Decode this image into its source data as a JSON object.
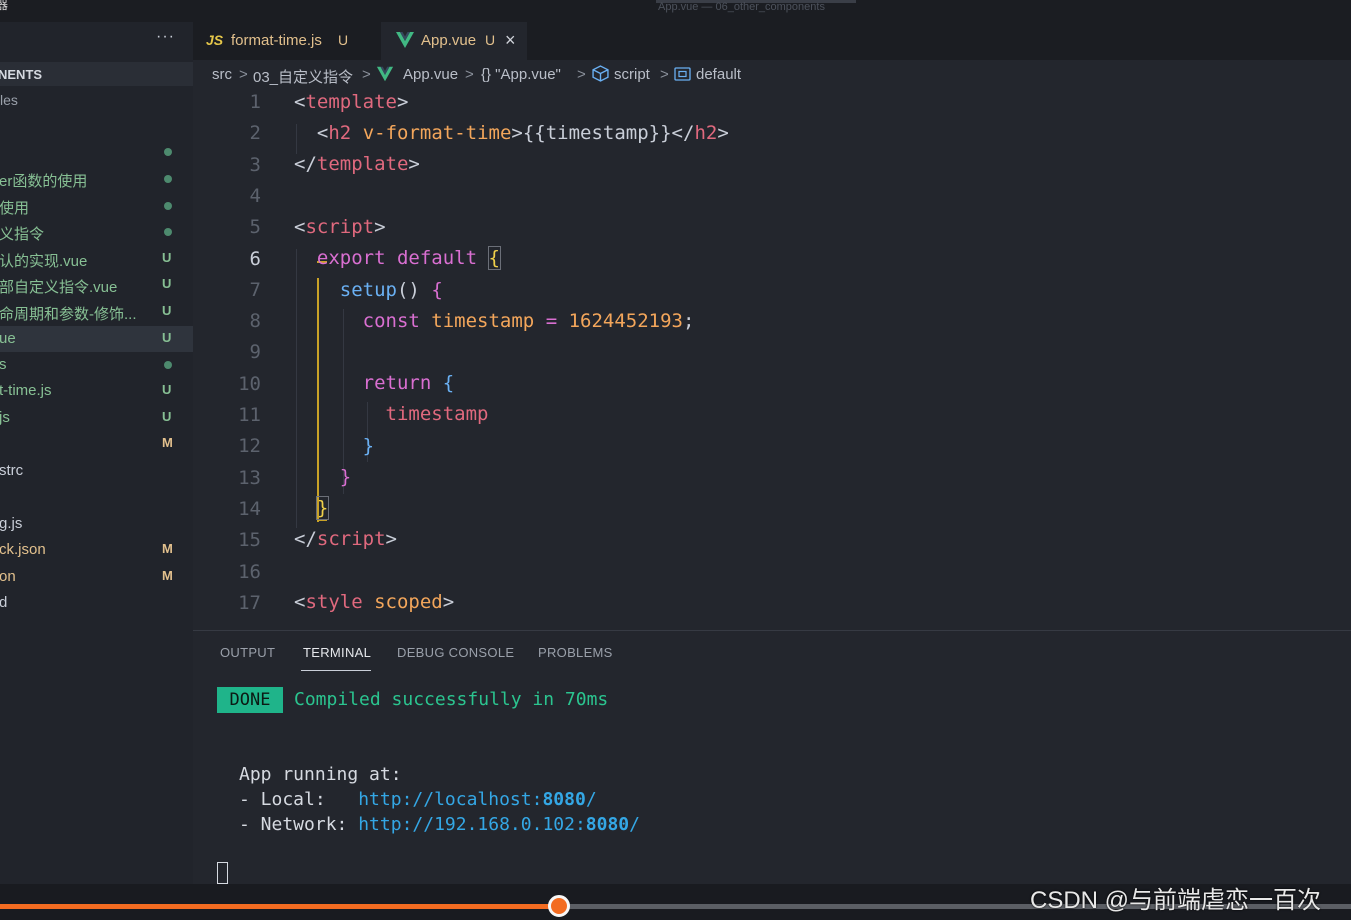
{
  "window": {
    "title": "App.vue — 06_other_components",
    "edge_char": "器"
  },
  "sidebar": {
    "more_label": "···",
    "section_title": "NENTS",
    "sub_title": "les",
    "items": [
      {
        "label": "",
        "badge": "",
        "dot": true,
        "color": "white"
      },
      {
        "label": "er函数的使用",
        "badge": "",
        "dot": true,
        "color": "green"
      },
      {
        "label": "使用",
        "badge": "",
        "dot": true,
        "color": "green"
      },
      {
        "label": "义指令",
        "badge": "",
        "dot": true,
        "color": "green"
      },
      {
        "label": "认的实现.vue",
        "badge": "U",
        "dot": false,
        "color": "green"
      },
      {
        "label": "部自定义指令.vue",
        "badge": "U",
        "dot": false,
        "color": "green"
      },
      {
        "label": "命周期和参数-修饰...",
        "badge": "U",
        "dot": false,
        "color": "green"
      },
      {
        "label": "ue",
        "badge": "U",
        "dot": false,
        "color": "green",
        "active": true
      },
      {
        "label": "s",
        "badge": "",
        "dot": true,
        "color": "green"
      },
      {
        "label": "t-time.js",
        "badge": "U",
        "dot": false,
        "color": "green"
      },
      {
        "label": "js",
        "badge": "U",
        "dot": false,
        "color": "green"
      },
      {
        "label": "",
        "badge": "M",
        "dot": false,
        "color": "yellow"
      },
      {
        "label": "strc",
        "badge": "",
        "dot": false,
        "color": "white"
      },
      {
        "label": "",
        "badge": "",
        "dot": false,
        "color": "white"
      },
      {
        "label": "g.js",
        "badge": "",
        "dot": false,
        "color": "white"
      },
      {
        "label": "ck.json",
        "badge": "M",
        "dot": false,
        "color": "yellow"
      },
      {
        "label": "on",
        "badge": "M",
        "dot": false,
        "color": "yellow"
      },
      {
        "label": "d",
        "badge": "",
        "dot": false,
        "color": "white"
      }
    ]
  },
  "tabs": [
    {
      "icon": "js-file-icon",
      "icon_text": "JS",
      "label": "format-time.js",
      "badge": "U",
      "active": false
    },
    {
      "icon": "vue-file-icon",
      "label": "App.vue",
      "badge": "U",
      "active": true,
      "close": "×"
    }
  ],
  "breadcrumb": {
    "src": "src",
    "folder": "03_自定义指令",
    "file": "App.vue",
    "module": "{} \"App.vue\"",
    "script": "script",
    "symbol": "default",
    "sep": ">"
  },
  "editor": {
    "current_line": 6,
    "lines": [
      {
        "n": "1"
      },
      {
        "n": "2"
      },
      {
        "n": "3"
      },
      {
        "n": "4"
      },
      {
        "n": "5"
      },
      {
        "n": "6"
      },
      {
        "n": "7"
      },
      {
        "n": "8"
      },
      {
        "n": "9"
      },
      {
        "n": "10"
      },
      {
        "n": "11"
      },
      {
        "n": "12"
      },
      {
        "n": "13"
      },
      {
        "n": "14"
      },
      {
        "n": "15"
      },
      {
        "n": "16"
      },
      {
        "n": "17"
      }
    ],
    "tokens": {
      "l1": [
        "<",
        "template",
        ">"
      ],
      "l2": [
        "<",
        "h2",
        "v-format-time",
        ">{{timestamp}}</",
        "h2",
        ">"
      ],
      "l3": [
        "</",
        "template",
        ">"
      ],
      "l5": [
        "<",
        "script",
        ">"
      ],
      "l6": [
        "export",
        "default",
        "{"
      ],
      "l7": [
        "setup",
        "()",
        "{"
      ],
      "l8": [
        "const",
        "timestamp",
        "=",
        "1624452193",
        ";"
      ],
      "l10": [
        "return",
        "{"
      ],
      "l11": [
        "timestamp"
      ],
      "l12": [
        "}"
      ],
      "l13": [
        "}"
      ],
      "l14": [
        "}"
      ],
      "l15": [
        "</",
        "script",
        ">"
      ],
      "l17": [
        "<",
        "style",
        "scoped",
        ">"
      ]
    }
  },
  "panel": {
    "tabs": [
      "OUTPUT",
      "TERMINAL",
      "DEBUG CONSOLE",
      "PROBLEMS"
    ],
    "active_tab": "TERMINAL",
    "terminal": {
      "done_badge": "DONE",
      "compiled": "Compiled successfully in 70ms",
      "app_running": "App running at:",
      "local_label": "- Local:   ",
      "local_url": "http://localhost:",
      "local_port": "8080",
      "local_slash": "/",
      "network_label": "- Network: ",
      "network_url": "http://192.168.0.102:",
      "network_port": "8080",
      "network_slash": "/"
    }
  },
  "video": {
    "progress_fraction": 0.414,
    "watermark": "CSDN @与前端虐恋一百次"
  },
  "colors": {
    "accent": "#f36c21",
    "done": "#1fb48a",
    "untracked": "#87c094",
    "modified": "#e2c08d"
  }
}
